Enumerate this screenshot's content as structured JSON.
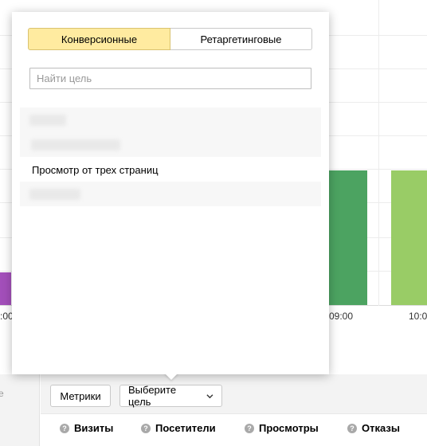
{
  "chart": {
    "x_ticks": [
      ":00",
      "09:00",
      "10:0"
    ],
    "bar_colors": {
      "purple": "#a34fba",
      "dark_green": "#4ca361",
      "light_green": "#99cc66"
    }
  },
  "popup": {
    "tabs": [
      {
        "label": "Конверсионные",
        "active": true
      },
      {
        "label": "Ретаргетинговые",
        "active": false
      }
    ],
    "search": {
      "placeholder": "Найти цель",
      "value": ""
    },
    "goals": [
      {
        "label": "",
        "redacted": true
      },
      {
        "label": "",
        "redacted": true
      },
      {
        "label": "Просмотр от трех страниц",
        "redacted": false
      },
      {
        "label": "",
        "redacted": true
      }
    ]
  },
  "toolbar": {
    "left_fragment": "e",
    "metrics_button": "Метрики",
    "goal_select": "Выберите цель"
  },
  "metrics": [
    {
      "label": "Визиты",
      "icon": "question-icon"
    },
    {
      "label": "Посетители",
      "icon": "question-icon"
    },
    {
      "label": "Просмотры",
      "icon": "question-icon"
    },
    {
      "label": "Отказы",
      "icon": "question-icon"
    }
  ]
}
